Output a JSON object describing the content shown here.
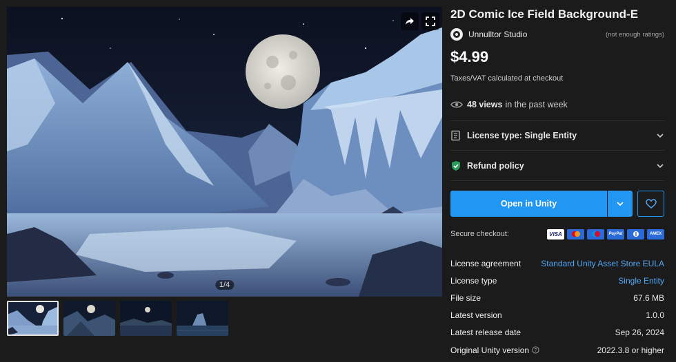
{
  "product": {
    "title": "2D Comic Ice Field Background-E",
    "publisher": "Unnulltor Studio",
    "rating_text": "(not enough ratings)",
    "price": "$4.99",
    "tax_note": "Taxes/VAT calculated at checkout"
  },
  "media": {
    "counter": "1/4",
    "thumbnail_count": 4,
    "active_thumbnail": 1
  },
  "views": {
    "count": "48 views",
    "suffix": "in the past week"
  },
  "accordions": {
    "license_label": "License type: Single Entity",
    "refund_label": "Refund policy"
  },
  "actions": {
    "open_label": "Open in Unity"
  },
  "checkout": {
    "label": "Secure checkout:",
    "methods": [
      "VISA",
      "Mastercard",
      "Maestro",
      "PayPal",
      "Diners Club",
      "American Express"
    ]
  },
  "details": [
    {
      "key": "License agreement",
      "value": "Standard Unity Asset Store EULA",
      "link": true
    },
    {
      "key": "License type",
      "value": "Single Entity",
      "link": true
    },
    {
      "key": "File size",
      "value": "67.6 MB",
      "link": false
    },
    {
      "key": "Latest version",
      "value": "1.0.0",
      "link": false
    },
    {
      "key": "Latest release date",
      "value": "Sep 26, 2024",
      "link": false
    },
    {
      "key": "Original Unity version",
      "value": "2022.3.8 or higher",
      "link": false,
      "info": true
    }
  ],
  "colors": {
    "background": "#1b1b1b",
    "accent": "#2196f3",
    "link": "#54a8f7",
    "shield": "#2a9d5a"
  },
  "icons": [
    "share-icon",
    "fullscreen-icon",
    "eye-icon",
    "license-icon",
    "shield-check-icon",
    "chevron-down-icon",
    "heart-icon",
    "info-icon"
  ]
}
